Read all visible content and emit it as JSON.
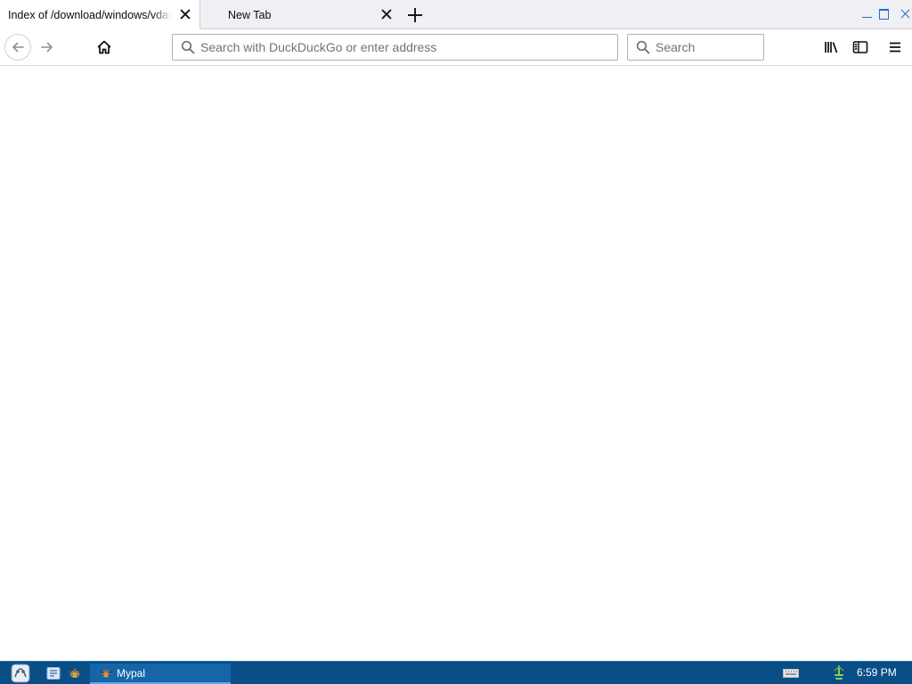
{
  "tabs": [
    {
      "label": "Index of /download/windows/vdag",
      "active": true
    },
    {
      "label": "New Tab",
      "active": false
    }
  ],
  "urlbar": {
    "placeholder": "Search with DuckDuckGo or enter address",
    "value": ""
  },
  "searchbar": {
    "placeholder": "Search",
    "value": ""
  },
  "toolbar_icons": [
    "back-arrow-icon",
    "forward-arrow-icon",
    "home-icon",
    "library-icon",
    "sidebars-icon",
    "menu-icon"
  ],
  "taskbar": {
    "task_label": "Mypal",
    "clock": "6:59 PM"
  },
  "colors": {
    "taskbar_bg": "#0a4e88",
    "task_active": "#1565a8",
    "window_control": "#1d6fc7"
  }
}
